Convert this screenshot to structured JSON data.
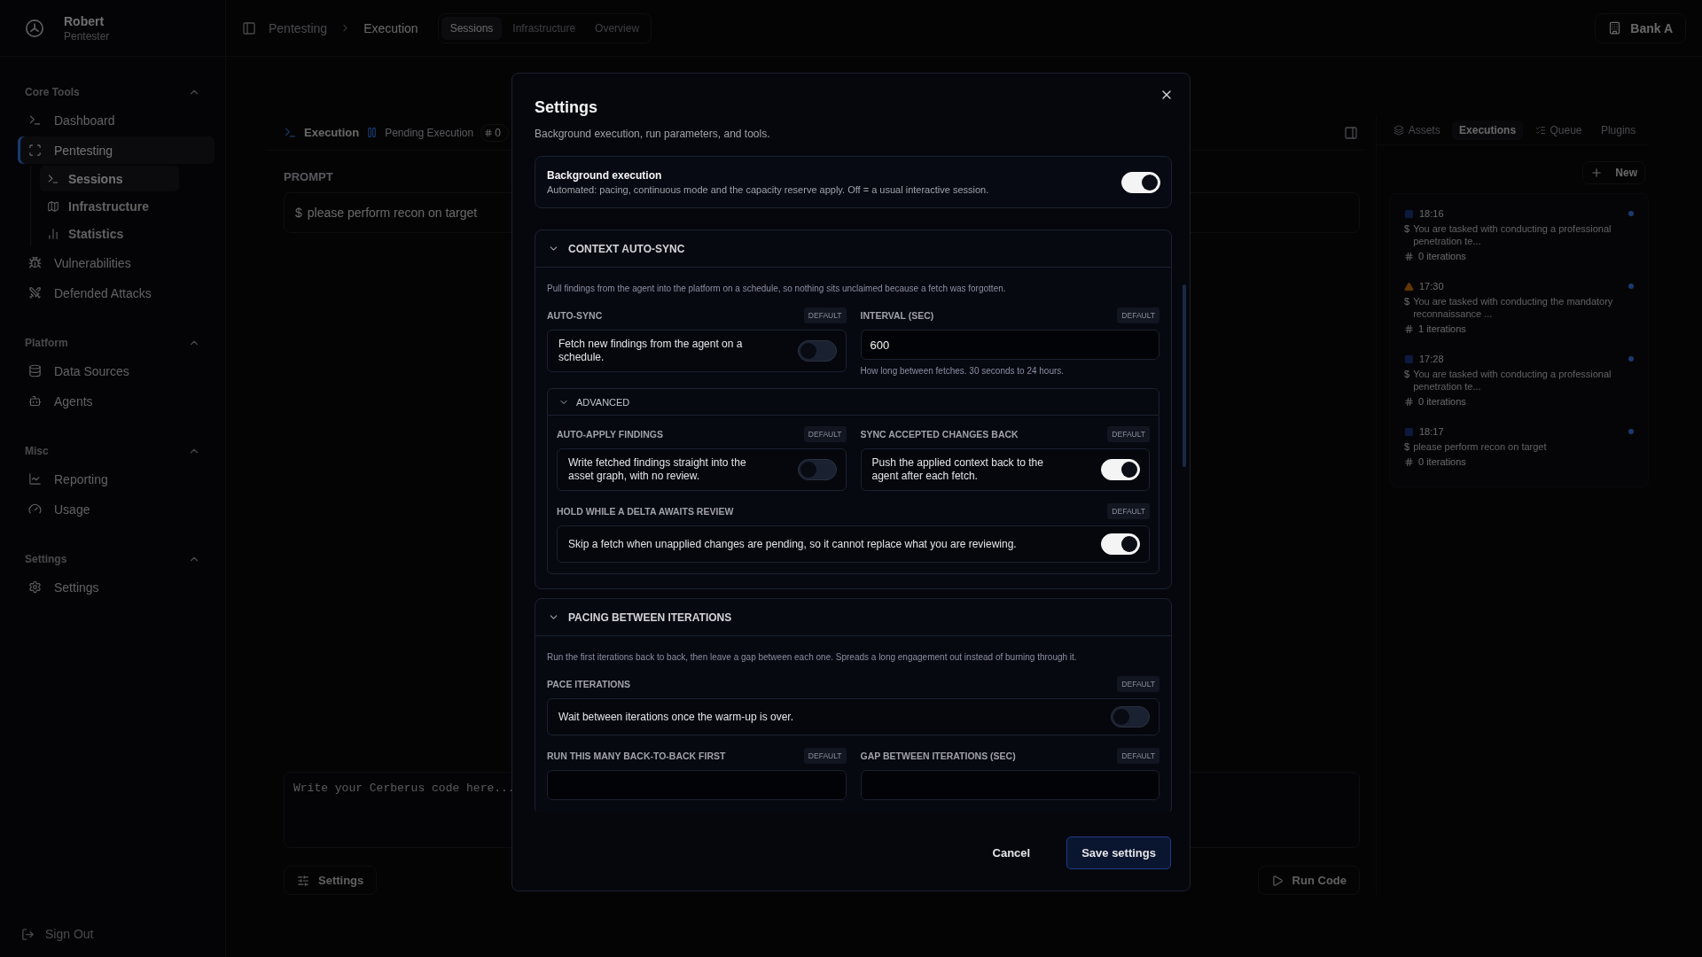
{
  "sidebar": {
    "user": {
      "name": "Robert",
      "role": "Pentester"
    },
    "sections": [
      {
        "title": "Core Tools",
        "expanded": true,
        "items": [
          {
            "label": "Dashboard",
            "selected": false
          },
          {
            "label": "Pentesting",
            "selected": true,
            "children": [
              {
                "label": "Sessions",
                "selected": true
              },
              {
                "label": "Infrastructure",
                "selected": false
              },
              {
                "label": "Statistics",
                "selected": false
              }
            ]
          },
          {
            "label": "Vulnerabilities",
            "selected": false
          },
          {
            "label": "Defended Attacks",
            "selected": false
          }
        ]
      },
      {
        "title": "Platform",
        "expanded": true,
        "items": [
          {
            "label": "Data Sources",
            "selected": false
          },
          {
            "label": "Agents",
            "selected": false
          }
        ]
      },
      {
        "title": "Misc",
        "expanded": true,
        "items": [
          {
            "label": "Reporting",
            "selected": false
          },
          {
            "label": "Usage",
            "selected": false
          }
        ]
      },
      {
        "title": "Settings",
        "expanded": true,
        "items": [
          {
            "label": "Settings",
            "selected": false
          }
        ]
      }
    ],
    "sign_out": "Sign Out"
  },
  "header": {
    "breadcrumb": [
      "Pentesting",
      "Execution"
    ],
    "tabs": [
      {
        "label": "Sessions",
        "selected": true
      },
      {
        "label": "Infrastructure",
        "selected": false
      },
      {
        "label": "Overview",
        "selected": false
      }
    ],
    "workspace": "Bank A"
  },
  "execution": {
    "tabs": [
      {
        "kind": "title",
        "label": "Execution"
      },
      {
        "kind": "status",
        "label": "Pending Execution"
      },
      {
        "kind": "chip",
        "label": "0"
      }
    ],
    "prompt_label": "PROMPT",
    "prompt_symbol": "$",
    "prompt": "please perform recon on target",
    "code_placeholder": "Write your Cerberus code here...",
    "settings_button": "Settings",
    "run_button": "Run Code"
  },
  "right_panel": {
    "tabs": [
      {
        "label": "Assets",
        "selected": false
      },
      {
        "label": "Executions",
        "selected": true
      },
      {
        "label": "Queue",
        "selected": false
      },
      {
        "label": "Plugins",
        "selected": false
      }
    ],
    "new_button": "New",
    "executions": [
      {
        "kind": "stopped",
        "time": "18:16",
        "symbol": "$",
        "prompt": "You are tasked with conducting a professional penetration te...",
        "iterations": "0 iterations"
      },
      {
        "kind": "warning",
        "time": "17:30",
        "symbol": "$",
        "prompt": "You are tasked with conducting the mandatory reconnaissance ...",
        "iterations": "1 iterations"
      },
      {
        "kind": "stopped",
        "time": "17:28",
        "symbol": "$",
        "prompt": "You are tasked with conducting a professional penetration te...",
        "iterations": "0 iterations"
      },
      {
        "kind": "stopped",
        "time": "18:17",
        "symbol": "$",
        "prompt": "please perform recon on target",
        "iterations": "0 iterations"
      }
    ]
  },
  "dialog": {
    "title": "Settings",
    "subtitle": "Background execution, run parameters, and tools.",
    "master": {
      "title": "Background execution",
      "description": "Automated: pacing, continuous mode and the capacity reserve apply. Off = a usual interactive session.",
      "on": true
    },
    "sections": [
      {
        "title": "CONTEXT AUTO-SYNC",
        "expanded": true,
        "description": "Pull findings from the agent into the platform on a schedule, so nothing sits unclaimed because a fetch was forgotten.",
        "fields": [
          {
            "kind": "toggle",
            "label": "AUTO-SYNC",
            "badge": "DEFAULT",
            "text": "Fetch new findings from the agent on a schedule.",
            "on": false
          },
          {
            "kind": "number",
            "label": "INTERVAL (SEC)",
            "badge": "DEFAULT",
            "value": "600",
            "help": "How long between fetches. 30 seconds to 24 hours."
          },
          {
            "kind": "group",
            "title": "ADVANCED",
            "expanded": true,
            "fields": [
              {
                "kind": "toggle",
                "label": "AUTO-APPLY FINDINGS",
                "badge": "DEFAULT",
                "text": "Write fetched findings straight into the asset graph, with no review.",
                "on": false
              },
              {
                "kind": "toggle",
                "label": "SYNC ACCEPTED CHANGES BACK",
                "badge": "DEFAULT",
                "text": "Push the applied context back to the agent after each fetch.",
                "on": true
              },
              {
                "kind": "toggle",
                "label": "HOLD WHILE A DELTA AWAITS REVIEW",
                "badge": "DEFAULT",
                "text": "Skip a fetch when unapplied changes are pending, so it cannot replace what you are reviewing.",
                "on": true,
                "wide": true
              }
            ]
          }
        ]
      },
      {
        "title": "PACING BETWEEN ITERATIONS",
        "expanded": true,
        "description": "Run the first iterations back to back, then leave a gap between each one. Spreads a long engagement out instead of burning through it.",
        "fields": [
          {
            "kind": "toggle",
            "label": "PACE ITERATIONS",
            "badge": "DEFAULT",
            "text": "Wait between iterations once the warm-up is over.",
            "on": false,
            "wide": true
          },
          {
            "kind": "number",
            "label": "RUN THIS MANY BACK-TO-BACK FIRST",
            "badge": "DEFAULT"
          },
          {
            "kind": "number",
            "label": "GAP BETWEEN ITERATIONS (SEC)",
            "badge": "DEFAULT"
          }
        ]
      }
    ],
    "buttons": [
      {
        "kind": "secondary",
        "label": "Cancel"
      },
      {
        "kind": "primary",
        "label": "Save settings"
      }
    ]
  }
}
